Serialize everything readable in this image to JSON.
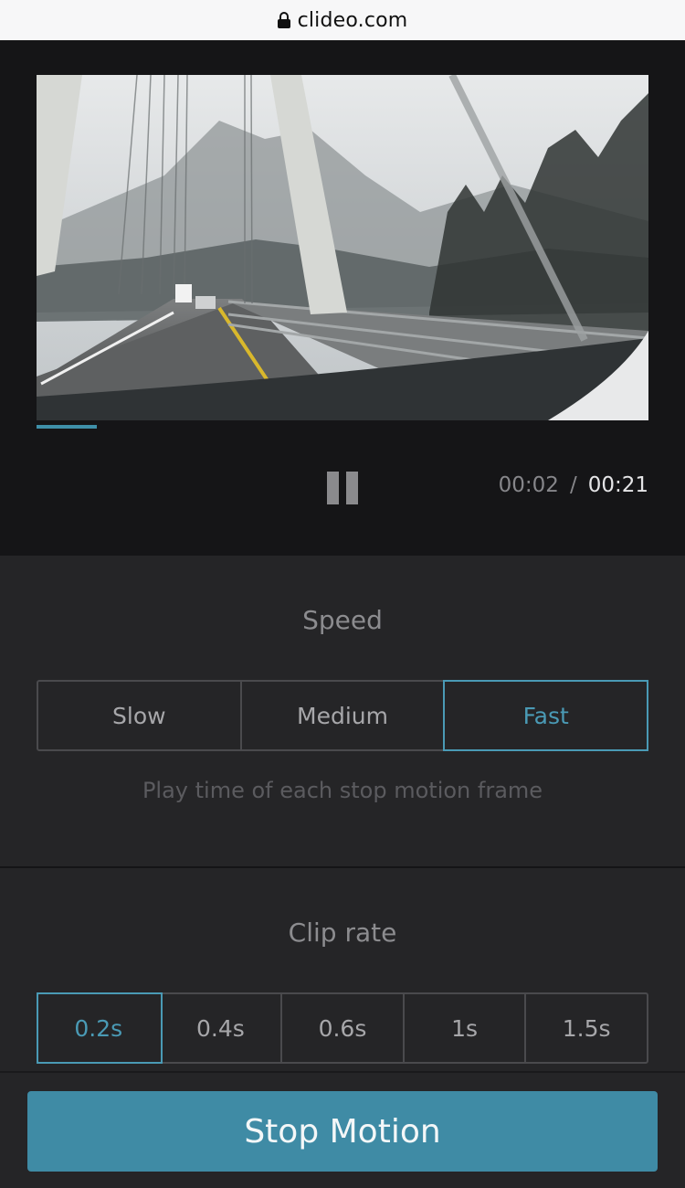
{
  "browser": {
    "domain": "clideo.com",
    "lock_icon": "lock-icon"
  },
  "player": {
    "current_time": "00:02",
    "separator": "/",
    "total_time": "00:21",
    "progress": 0.1,
    "pause_icon": "pause-icon",
    "preview_icon": "video-frame-image"
  },
  "speed": {
    "title": "Speed",
    "options": [
      "Slow",
      "Medium",
      "Fast"
    ],
    "selected": "Fast",
    "help": "Play time of each stop motion frame"
  },
  "clip_rate": {
    "title": "Clip rate",
    "options": [
      "0.2s",
      "0.4s",
      "0.6s",
      "1s",
      "1.5s"
    ],
    "selected": "0.2s"
  },
  "action": {
    "label": "Stop Motion"
  },
  "colors": {
    "accent": "#3f8ba5",
    "active": "#4a9ab5",
    "background": "#252527",
    "player_bg": "#151517"
  }
}
